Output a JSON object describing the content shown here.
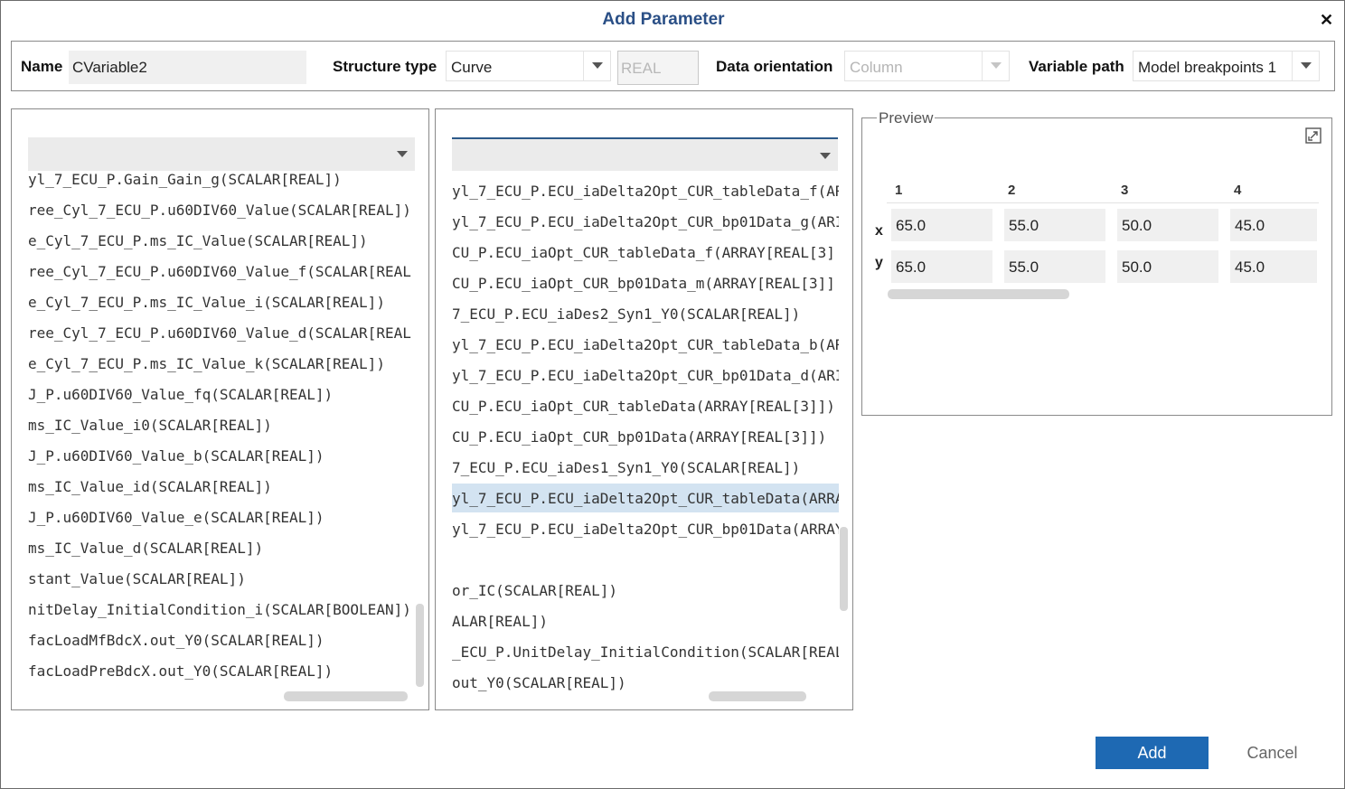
{
  "dialog": {
    "title": "Add Parameter"
  },
  "toolbar": {
    "name_label": "Name",
    "name_value": "CVariable2",
    "structure_label": "Structure type",
    "structure_value": "Curve",
    "datatype_value": "REAL",
    "orientation_label": "Data orientation",
    "orientation_value": "Column",
    "varpath_label": "Variable path",
    "varpath_value": "Model breakpoints 1"
  },
  "left_list": {
    "items": [
      "yl_7_ECU_P.Gain_Gain_g(SCALAR[REAL])",
      "ree_Cyl_7_ECU_P.u60DIV60_Value(SCALAR[REAL])",
      "e_Cyl_7_ECU_P.ms_IC_Value(SCALAR[REAL])",
      "ree_Cyl_7_ECU_P.u60DIV60_Value_f(SCALAR[REAL",
      "e_Cyl_7_ECU_P.ms_IC_Value_i(SCALAR[REAL])",
      "ree_Cyl_7_ECU_P.u60DIV60_Value_d(SCALAR[REAL",
      "e_Cyl_7_ECU_P.ms_IC_Value_k(SCALAR[REAL])",
      "J_P.u60DIV60_Value_fq(SCALAR[REAL])",
      "ms_IC_Value_i0(SCALAR[REAL])",
      "J_P.u60DIV60_Value_b(SCALAR[REAL])",
      "ms_IC_Value_id(SCALAR[REAL])",
      "J_P.u60DIV60_Value_e(SCALAR[REAL])",
      "ms_IC_Value_d(SCALAR[REAL])",
      "stant_Value(SCALAR[REAL])",
      "nitDelay_InitialCondition_i(SCALAR[BOOLEAN])",
      "facLoadMfBdcX.out_Y0(SCALAR[REAL])",
      "facLoadPreBdcX.out_Y0(SCALAR[REAL])"
    ]
  },
  "right_list": {
    "items": [
      "yl_7_ECU_P.ECU_iaDelta2Opt_CUR_tableData_f(AR",
      "yl_7_ECU_P.ECU_iaDelta2Opt_CUR_bp01Data_g(ARI",
      "CU_P.ECU_iaOpt_CUR_tableData_f(ARRAY[REAL[3]",
      "CU_P.ECU_iaOpt_CUR_bp01Data_m(ARRAY[REAL[3]]",
      "7_ECU_P.ECU_iaDes2_Syn1_Y0(SCALAR[REAL])",
      "yl_7_ECU_P.ECU_iaDelta2Opt_CUR_tableData_b(AR",
      "yl_7_ECU_P.ECU_iaDelta2Opt_CUR_bp01Data_d(ARI",
      "CU_P.ECU_iaOpt_CUR_tableData(ARRAY[REAL[3]])",
      "CU_P.ECU_iaOpt_CUR_bp01Data(ARRAY[REAL[3]])",
      "7_ECU_P.ECU_iaDes1_Syn1_Y0(SCALAR[REAL])",
      "yl_7_ECU_P.ECU_iaDelta2Opt_CUR_tableData(ARRA",
      "yl_7_ECU_P.ECU_iaDelta2Opt_CUR_bp01Data(ARRAY",
      "",
      "or_IC(SCALAR[REAL])",
      "ALAR[REAL])",
      "_ECU_P.UnitDelay_InitialCondition(SCALAR[REAL",
      "out_Y0(SCALAR[REAL])"
    ],
    "selected_index": 10
  },
  "preview": {
    "label": "Preview",
    "columns": [
      "1",
      "2",
      "3",
      "4"
    ],
    "rows": [
      {
        "label": "x",
        "values": [
          "65.0",
          "55.0",
          "50.0",
          "45.0"
        ]
      },
      {
        "label": "y",
        "values": [
          "65.0",
          "55.0",
          "50.0",
          "45.0"
        ]
      }
    ]
  },
  "buttons": {
    "add": "Add",
    "cancel": "Cancel"
  },
  "colors": {
    "accent": "#1e69b3",
    "title": "#2a4f86",
    "selection": "#d3e3f1"
  }
}
